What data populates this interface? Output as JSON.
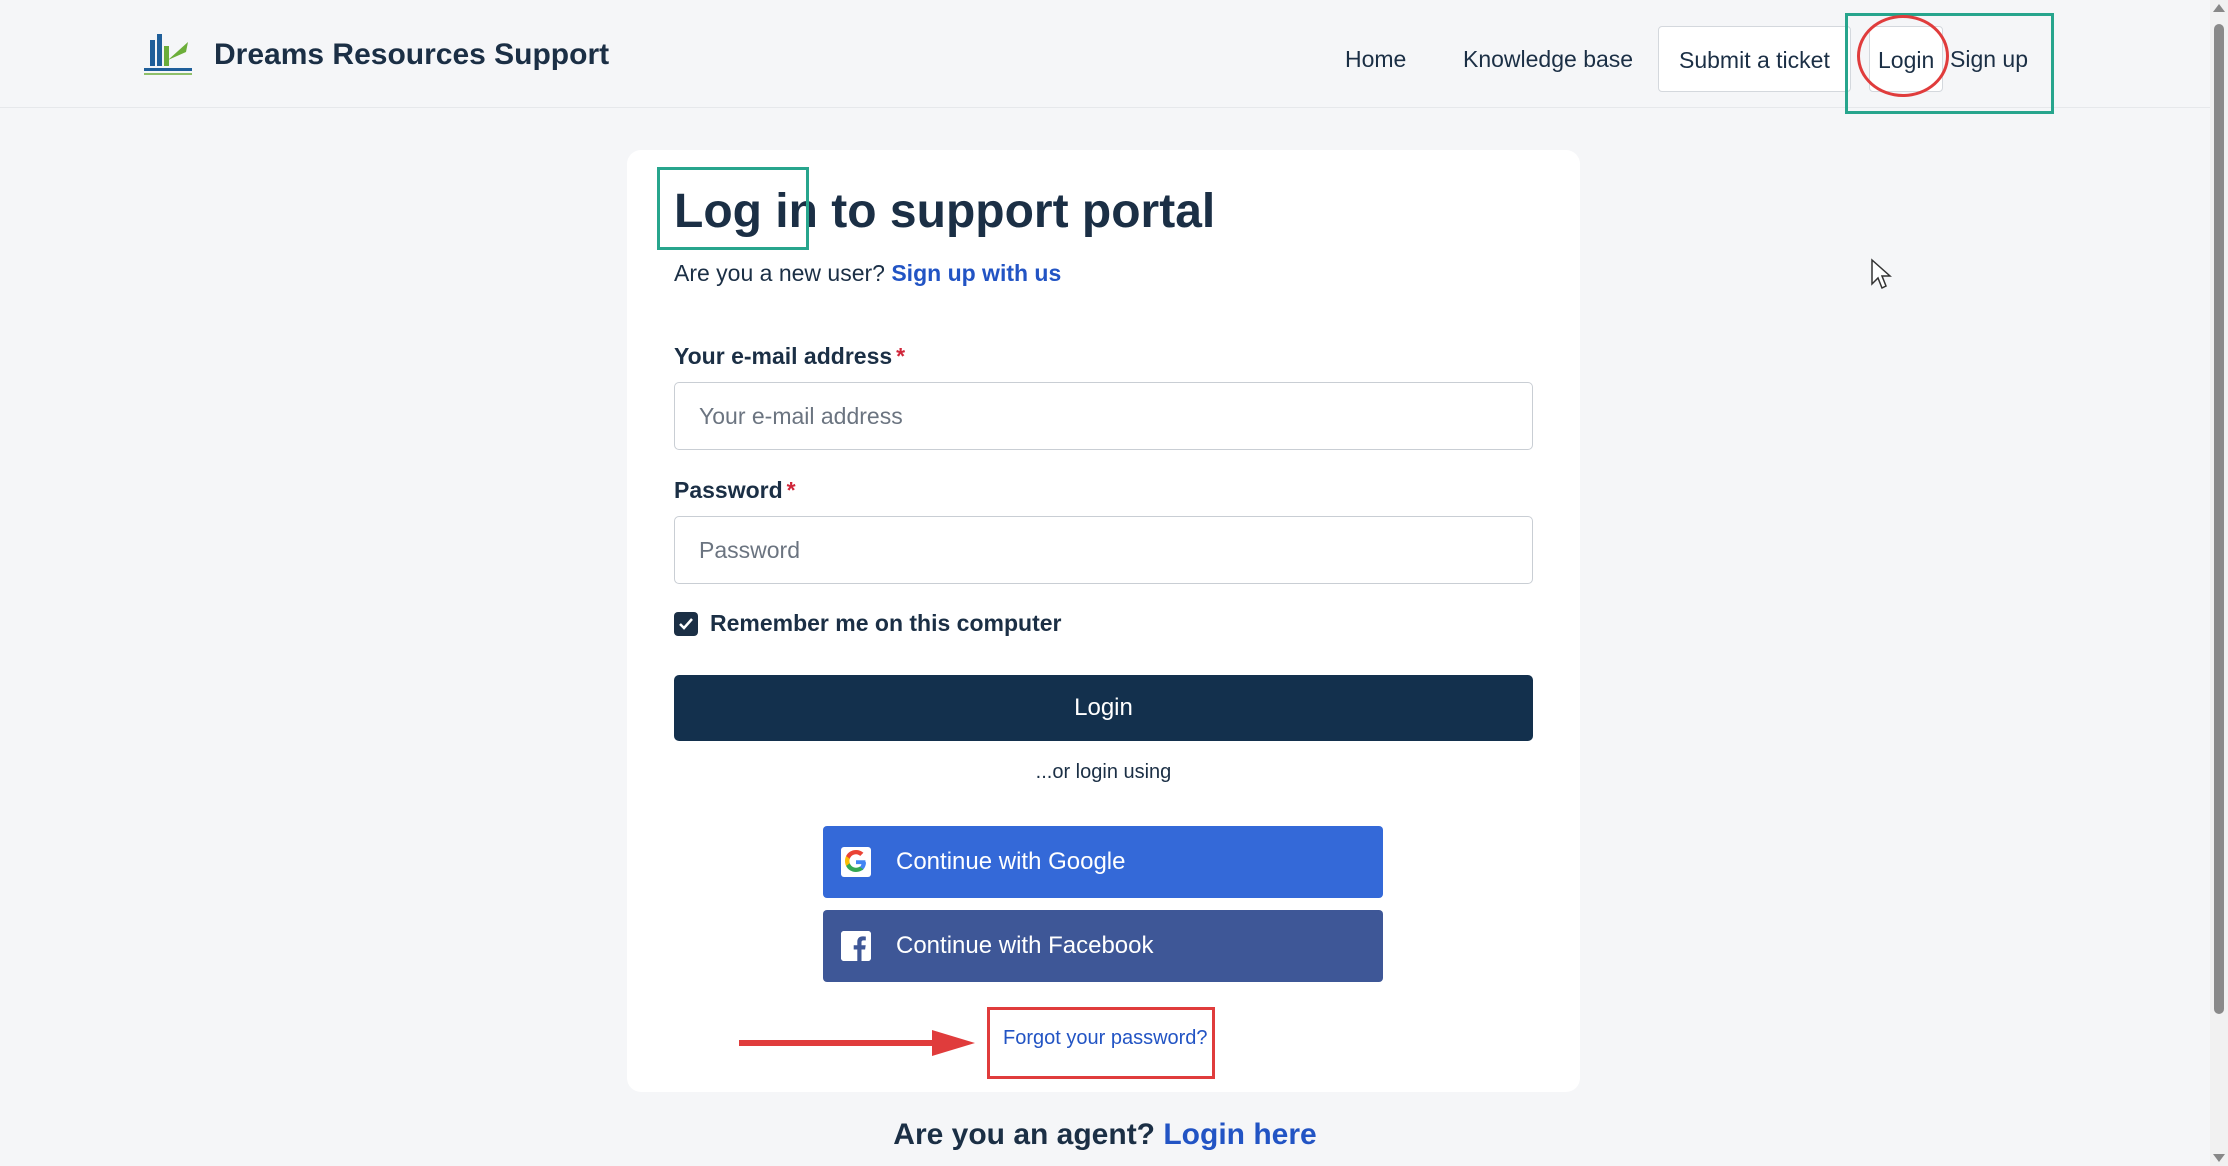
{
  "header": {
    "brand_name": "Dreams Resources Support",
    "nav": {
      "home": "Home",
      "knowledge_base": "Knowledge base",
      "submit_ticket": "Submit a ticket",
      "login": "Login",
      "signup": "Sign up"
    }
  },
  "login_card": {
    "title": "Log in to support portal",
    "subtitle_prefix": "Are you a new user?",
    "signup_link": "Sign up with us",
    "email": {
      "label": "Your e-mail address",
      "required_mark": "*",
      "placeholder": "Your e-mail address",
      "value": ""
    },
    "password": {
      "label": "Password",
      "required_mark": "*",
      "placeholder": "Password",
      "value": ""
    },
    "remember_me": {
      "label": "Remember me on this computer",
      "checked": true
    },
    "login_button": "Login",
    "or_login_text": "...or login using",
    "google_button": "Continue with Google",
    "facebook_button": "Continue with Facebook",
    "forgot_password": "Forgot your password?"
  },
  "agent_prompt": {
    "text": "Are you an agent?",
    "link": "Login here"
  },
  "colors": {
    "primary_dark": "#13304d",
    "link_blue": "#2254c4",
    "google_blue": "#3469d8",
    "facebook_blue": "#3e5797",
    "annotation_green": "#27a58d",
    "annotation_red": "#e03c3c"
  }
}
